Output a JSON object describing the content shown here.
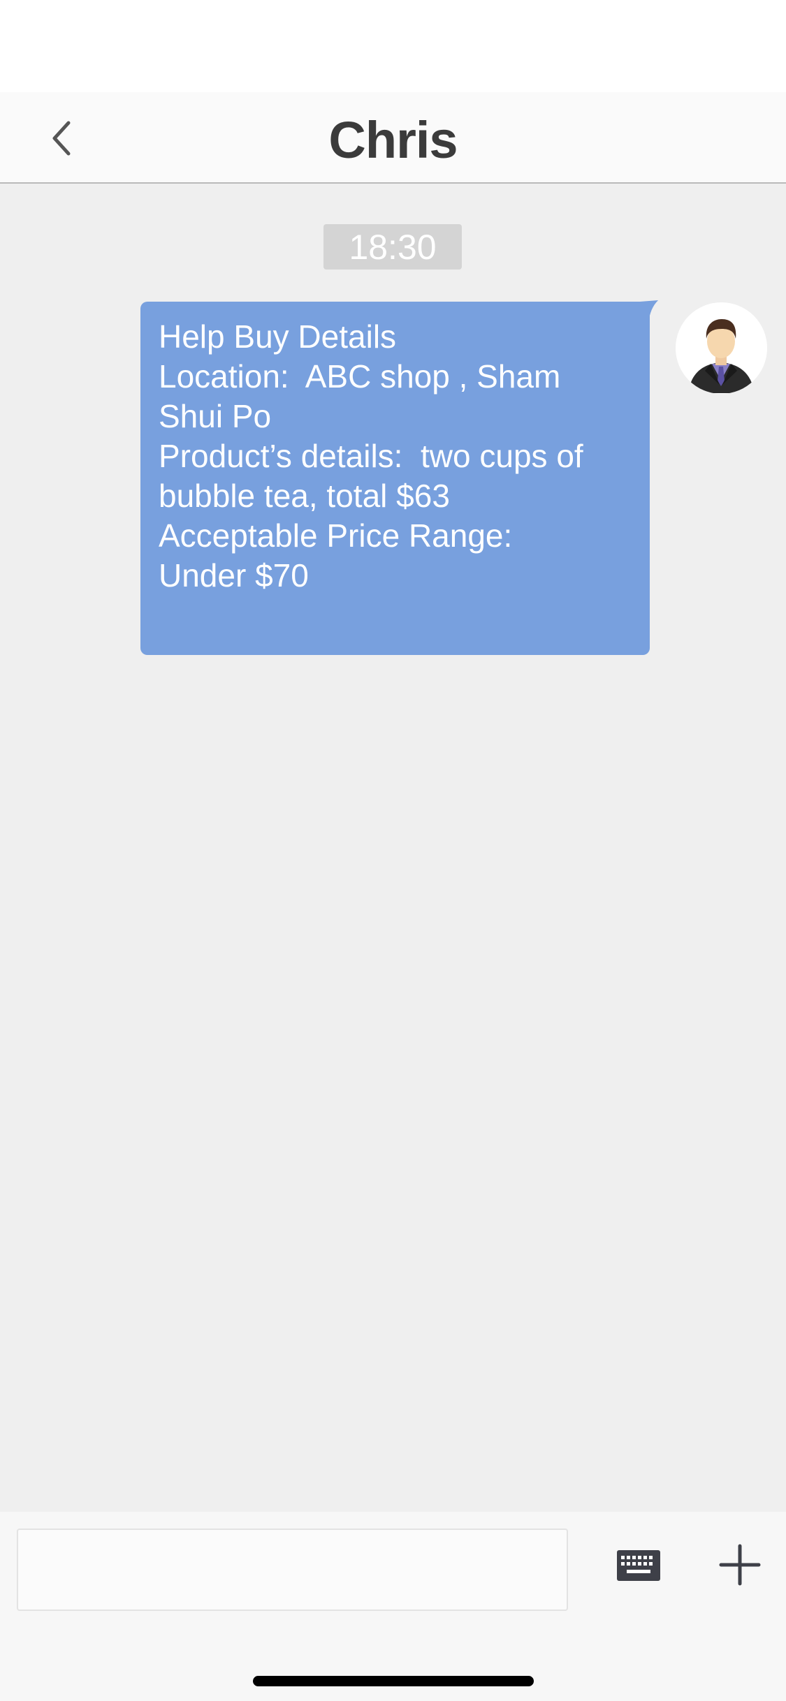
{
  "nav": {
    "title": "Chris",
    "back_icon": "chevron-left-icon"
  },
  "chat": {
    "timestamp": "18:30",
    "message": {
      "lines": [
        "Help Buy Details",
        "Location:  ABC shop , Sham",
        "Shui Po",
        "Product’s details:  two cups of",
        "bubble tea, total $63",
        "Acceptable Price Range:",
        "Under $70"
      ]
    },
    "avatar_icon": "user-avatar-icon"
  },
  "input_bar": {
    "text_value": "",
    "keyboard_icon": "keyboard-icon",
    "plus_icon": "plus-icon"
  },
  "colors": {
    "bubble": "#78a0de",
    "chat_background": "#efefef",
    "time_badge": "#d4d4d4",
    "title_text": "#3b3b3b"
  }
}
